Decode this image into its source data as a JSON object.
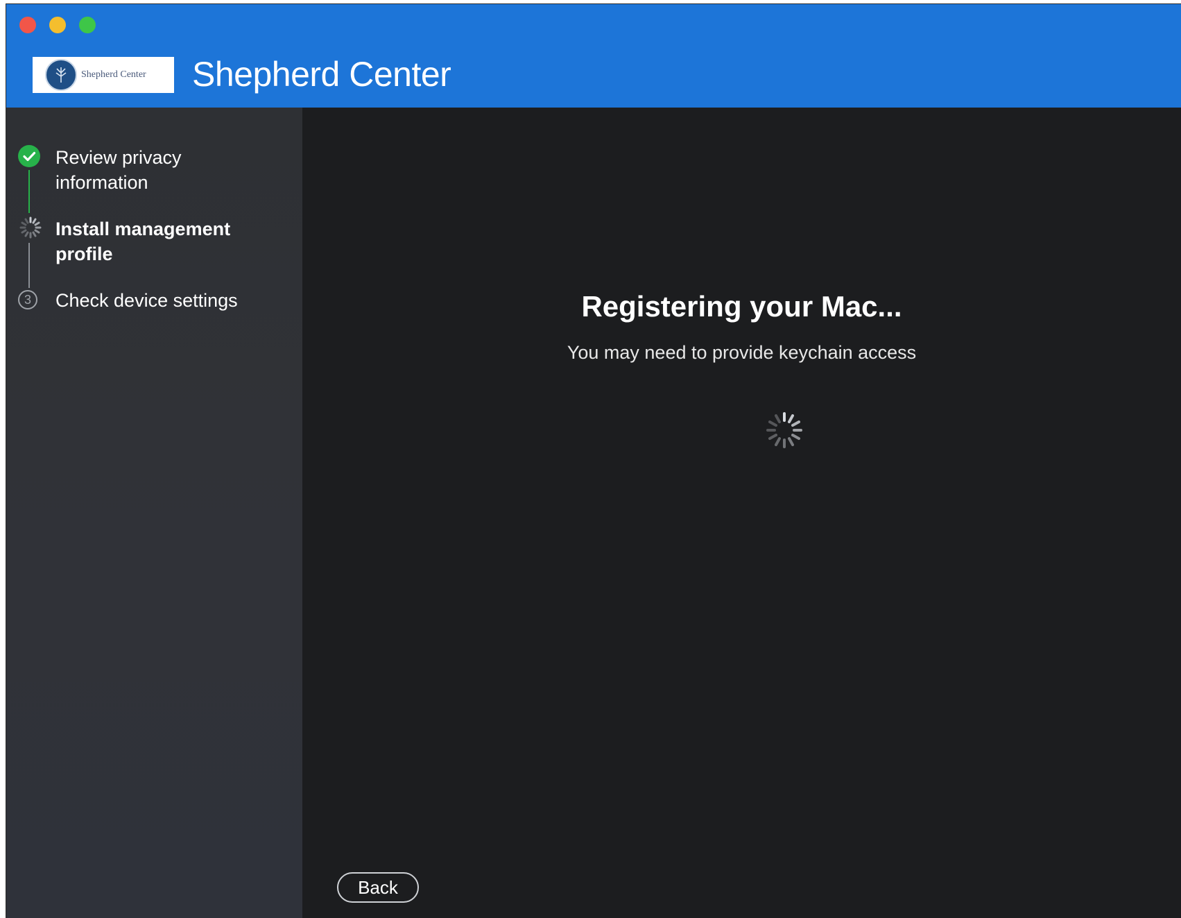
{
  "window": {
    "title": "Shepherd Center",
    "logo_text": "Shepherd Center",
    "colors": {
      "titlebar": "#1d75d8",
      "content": "#1c1d1f",
      "sidebar": "#2f3237",
      "success": "#27b24a"
    }
  },
  "sidebar": {
    "steps": [
      {
        "label_line1": "Review privacy",
        "label_line2": "information",
        "status": "complete",
        "icon": "checkmark-icon"
      },
      {
        "label_line1": "Install management",
        "label_line2": "profile",
        "status": "in-progress",
        "icon": "spinner-icon"
      },
      {
        "label": "Check device settings",
        "number": "3",
        "status": "pending",
        "icon": "step-number-icon"
      }
    ]
  },
  "main": {
    "heading": "Registering your Mac...",
    "subheading": "You may need to provide keychain access",
    "back_label": "Back"
  }
}
